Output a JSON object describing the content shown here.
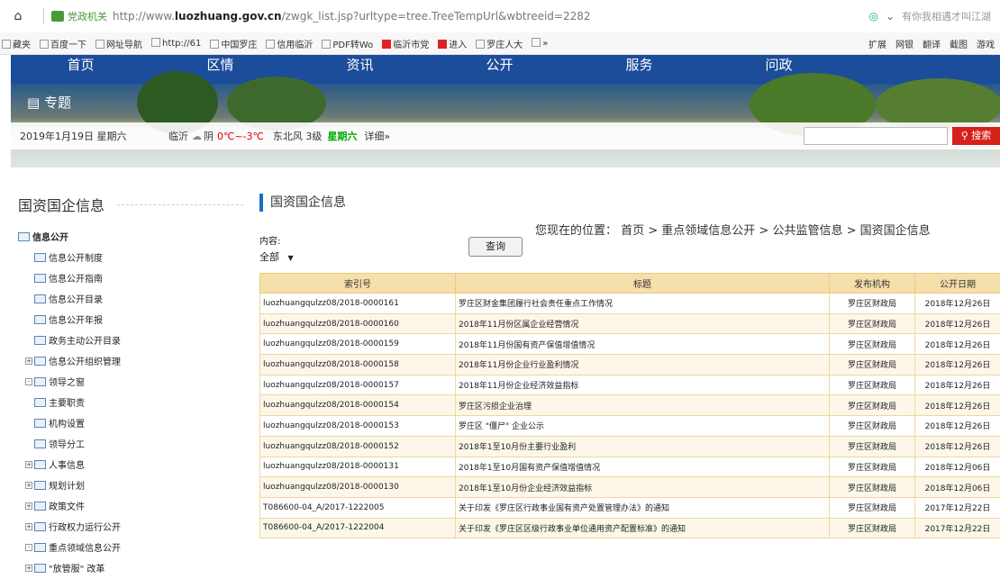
{
  "browser": {
    "url_prefix": "http://www.",
    "url_domain": "luozhuang.gov.cn",
    "url_path": "/zwgk_list.jsp?urltype=tree.TreeTempUrl&wbtreeid=2282",
    "site_label": "党政机关",
    "search_hint": "有你我相遇才叫江湖",
    "bookmarks": [
      "藏夹",
      "百度一下",
      "网址导航",
      "http://61",
      "中国罗庄",
      "信用临沂",
      "PDF转Wo",
      "临沂市党",
      "进入",
      "罗庄人大",
      "»"
    ],
    "extensions": [
      "扩展",
      "网银",
      "翻译",
      "截图",
      "游戏"
    ]
  },
  "banner": {
    "nav": [
      "首页",
      "区情",
      "资讯",
      "公开",
      "服务",
      "问政"
    ],
    "topic": "专题",
    "date": "2019年1月19日 星期六",
    "city": "临沂",
    "weather": "阴",
    "temp": "0℃~-3℃",
    "wind": "东北风 3级",
    "day": "星期六",
    "detail": "详细»",
    "search_label": "搜索"
  },
  "sidebar": {
    "title": "国资国企信息",
    "root": "信息公开",
    "items": [
      {
        "label": "信息公开制度",
        "expand": ""
      },
      {
        "label": "信息公开指南",
        "expand": ""
      },
      {
        "label": "信息公开目录",
        "expand": ""
      },
      {
        "label": "信息公开年报",
        "expand": ""
      },
      {
        "label": "政务主动公开目录",
        "expand": ""
      },
      {
        "label": "信息公开组织管理",
        "expand": "+"
      },
      {
        "label": "领导之窗",
        "expand": "-"
      },
      {
        "label": "主要职责",
        "expand": ""
      },
      {
        "label": "机构设置",
        "expand": ""
      },
      {
        "label": "领导分工",
        "expand": ""
      },
      {
        "label": "人事信息",
        "expand": "+"
      },
      {
        "label": "规划计划",
        "expand": "+"
      },
      {
        "label": "政策文件",
        "expand": "+"
      },
      {
        "label": "行政权力运行公开",
        "expand": "+"
      },
      {
        "label": "重点领域信息公开",
        "expand": "-"
      },
      {
        "label": "\"放管服\" 改革",
        "expand": "+"
      }
    ]
  },
  "main": {
    "title": "国资国企信息",
    "breadcrumb": "您现在的位置： 首页 > 重点领域信息公开 > 公共监管信息 > 国资国企信息",
    "filter_label": "内容:",
    "filter_value": "全部",
    "query_label": "查询",
    "columns": [
      "索引号",
      "标题",
      "发布机构",
      "公开日期"
    ],
    "rows": [
      [
        "luozhuangqulzz08/2018-0000161",
        "罗庄区财金集团履行社会责任重点工作情况",
        "罗庄区财政局",
        "2018年12月26日"
      ],
      [
        "luozhuangqulzz08/2018-0000160",
        "2018年11月份区属企业经营情况",
        "罗庄区财政局",
        "2018年12月26日"
      ],
      [
        "luozhuangqulzz08/2018-0000159",
        "2018年11月份国有资产保值增值情况",
        "罗庄区财政局",
        "2018年12月26日"
      ],
      [
        "luozhuangqulzz08/2018-0000158",
        "2018年11月份企业行业盈利情况",
        "罗庄区财政局",
        "2018年12月26日"
      ],
      [
        "luozhuangqulzz08/2018-0000157",
        "2018年11月份企业经济效益指标",
        "罗庄区财政局",
        "2018年12月26日"
      ],
      [
        "luozhuangqulzz08/2018-0000154",
        "罗庄区污损企业治理",
        "罗庄区财政局",
        "2018年12月26日"
      ],
      [
        "luozhuangqulzz08/2018-0000153",
        "罗庄区 \"僵尸\" 企业公示",
        "罗庄区财政局",
        "2018年12月26日"
      ],
      [
        "luozhuangqulzz08/2018-0000152",
        "2018年1至10月份主要行业盈利",
        "罗庄区财政局",
        "2018年12月26日"
      ],
      [
        "luozhuangqulzz08/2018-0000131",
        "2018年1至10月国有资产保值增值情况",
        "罗庄区财政局",
        "2018年12月06日"
      ],
      [
        "luozhuangqulzz08/2018-0000130",
        "2018年1至10月份企业经济效益指标",
        "罗庄区财政局",
        "2018年12月06日"
      ],
      [
        "T086600-04_A/2017-1222005",
        "关于印发《罗庄区行政事业国有资产处置管理办法》的通知",
        "罗庄区财政局",
        "2017年12月22日"
      ],
      [
        "T086600-04_A/2017-1222004",
        "关于印发《罗庄区区级行政事业单位通用资产配置标准》的通知",
        "罗庄区财政局",
        "2017年12月22日"
      ]
    ]
  }
}
